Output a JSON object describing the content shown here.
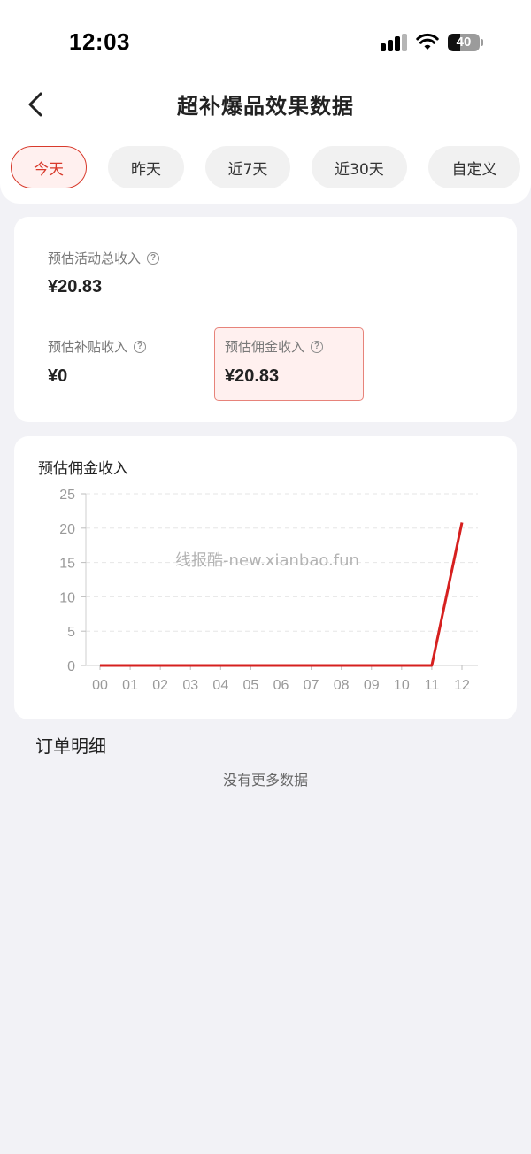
{
  "status_bar": {
    "time": "12:03",
    "battery_level": "40",
    "icons": [
      "cellular-signal-icon",
      "wifi-icon",
      "battery-icon"
    ]
  },
  "nav": {
    "back_icon": "chevron-left-icon",
    "title": "超补爆品效果数据"
  },
  "tabs": [
    {
      "label": "今天",
      "active": true
    },
    {
      "label": "昨天",
      "active": false
    },
    {
      "label": "近7天",
      "active": false
    },
    {
      "label": "近30天",
      "active": false
    },
    {
      "label": "自定义",
      "active": false
    }
  ],
  "summary": {
    "total": {
      "label": "预估活动总收入",
      "value": "¥20.83"
    },
    "subsidy": {
      "label": "预估补贴收入",
      "value": "¥0"
    },
    "commission": {
      "label": "预估佣金收入",
      "value": "¥20.83"
    },
    "help_icon": "question-circle-icon"
  },
  "chart_data": {
    "type": "line",
    "title": "预估佣金收入",
    "xlabel": "",
    "ylabel": "",
    "categories": [
      "00",
      "01",
      "02",
      "03",
      "04",
      "05",
      "06",
      "07",
      "08",
      "09",
      "10",
      "11",
      "12"
    ],
    "values": [
      0,
      0,
      0,
      0,
      0,
      0,
      0,
      0,
      0,
      0,
      0,
      0,
      20.83
    ],
    "y_ticks": [
      0,
      5,
      10,
      15,
      20,
      25
    ],
    "ylim": [
      0,
      25
    ],
    "grid": "horizontal-dashed",
    "line_color": "#d6201f",
    "watermark": "线报酷-new.xianbao.fun"
  },
  "orders": {
    "title": "订单明细",
    "empty_text": "没有更多数据"
  },
  "colors": {
    "accent": "#d83a2c",
    "accent_bg": "#fff0ef",
    "page_bg": "#f2f2f6"
  }
}
